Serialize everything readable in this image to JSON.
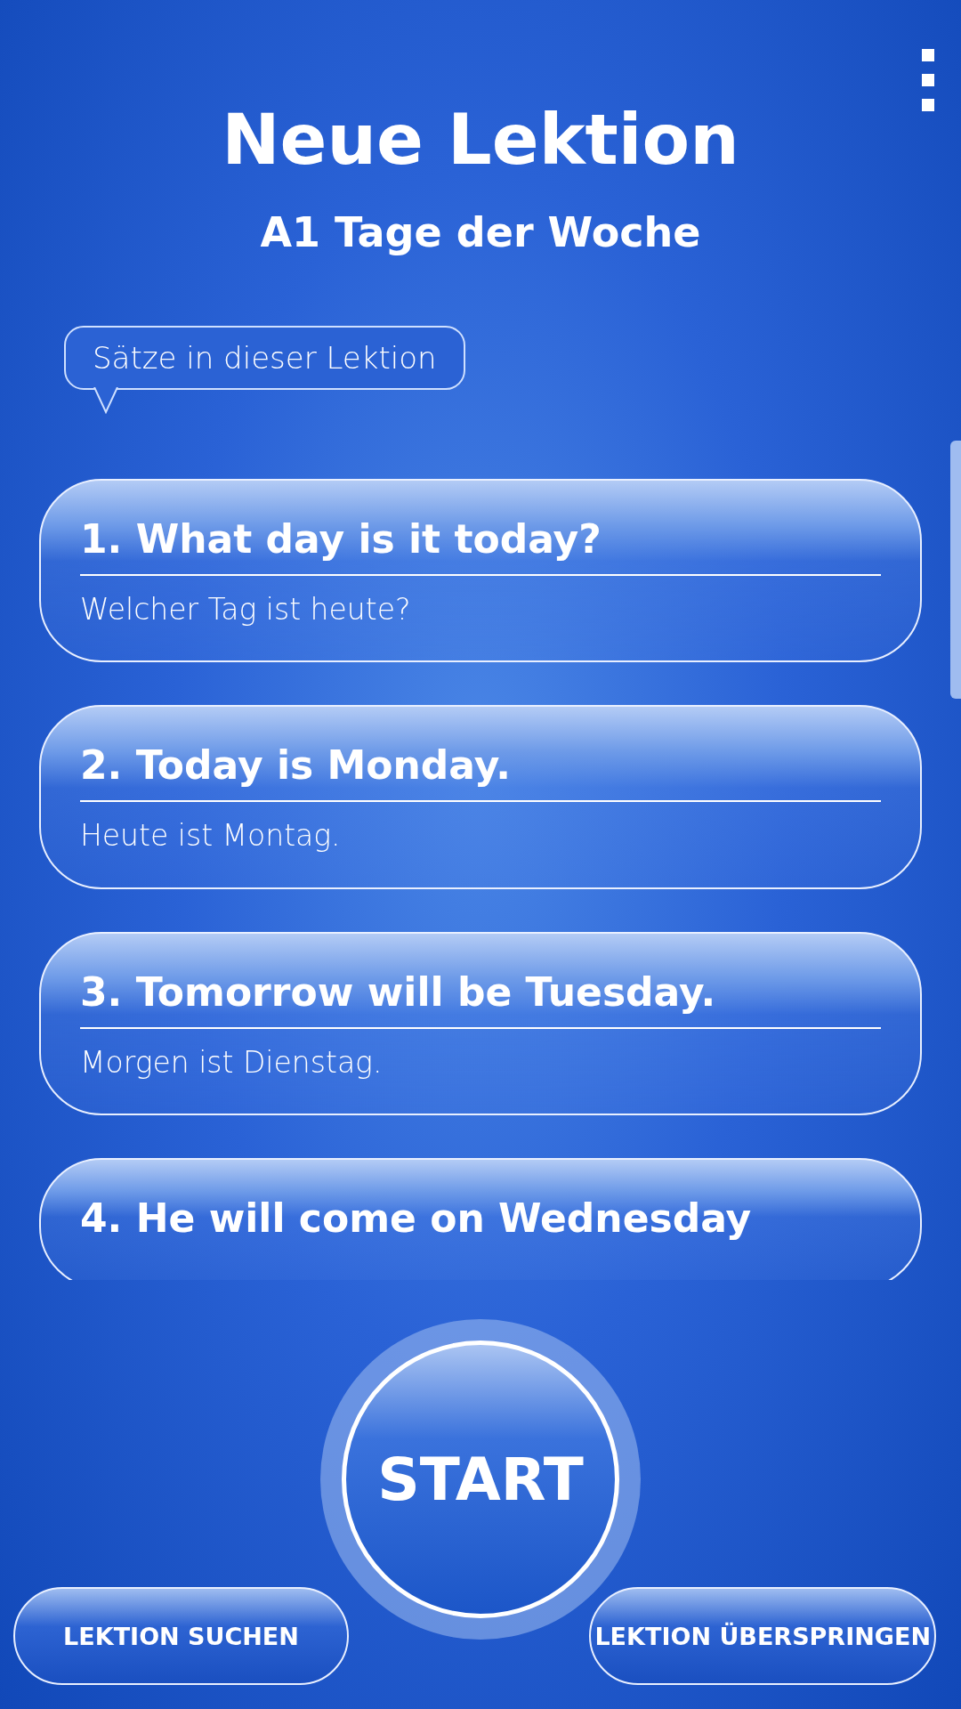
{
  "header": {
    "title": "Neue Lektion",
    "subtitle": "A1 Tage der Woche"
  },
  "bubble": {
    "text": "Sätze in dieser Lektion"
  },
  "sentences": [
    {
      "english": "1. What day is it today?",
      "german": "Welcher Tag ist heute?"
    },
    {
      "english": "2. Today is Monday.",
      "german": "Heute ist Montag."
    },
    {
      "english": "3. Tomorrow will be Tuesday.",
      "german": "Morgen ist Dienstag."
    },
    {
      "english": "4. He will come on Wednesday"
    }
  ],
  "start_button": {
    "label": "START"
  },
  "buttons": [
    {
      "label": "LEKTION SUCHEN"
    },
    {
      "label": "LEKTION ÜBERSPRINGEN"
    }
  ]
}
